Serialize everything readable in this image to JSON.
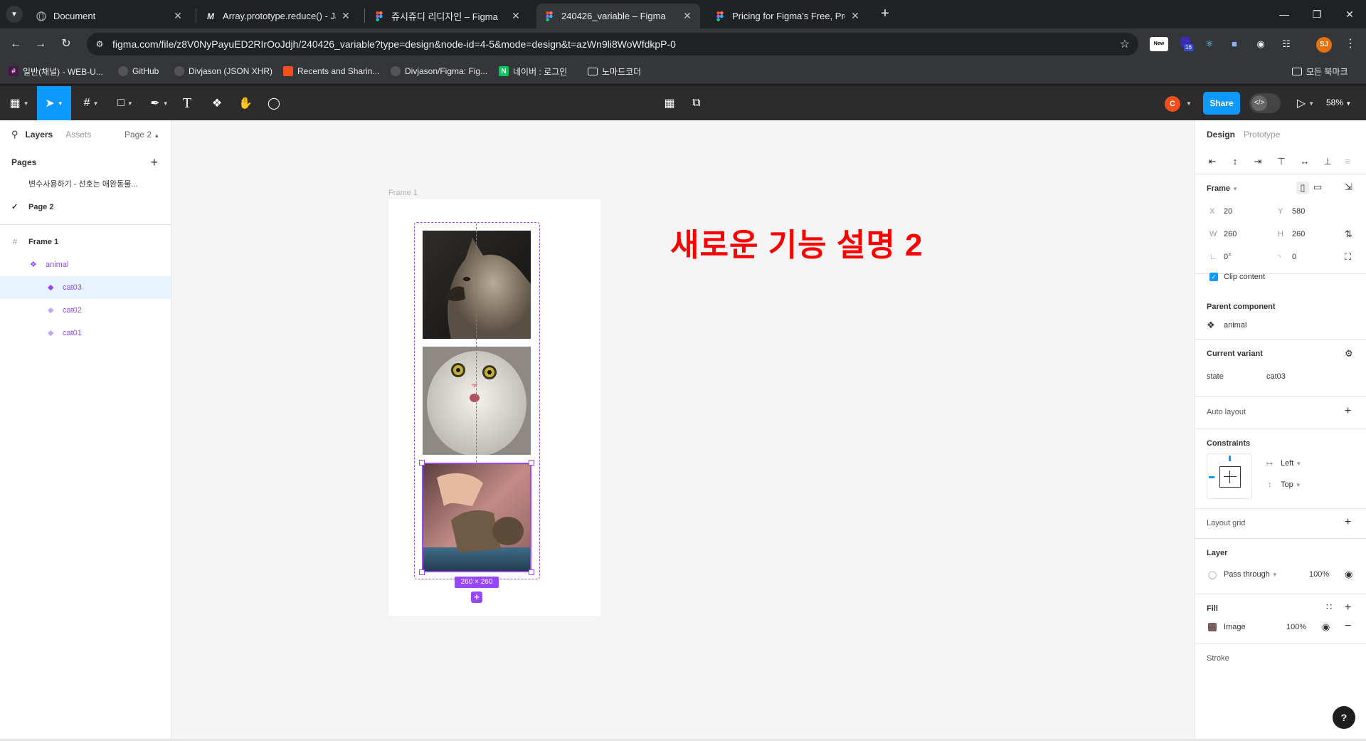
{
  "browser": {
    "tabs": [
      {
        "title": "Document",
        "icon": "globe-icon"
      },
      {
        "title": "Array.prototype.reduce() - Java",
        "icon": "mdn-icon",
        "glyph": "M"
      },
      {
        "title": "쥬시쥬디 리디자인 – Figma",
        "icon": "figma-icon"
      },
      {
        "title": "240426_variable – Figma",
        "icon": "figma-icon"
      },
      {
        "title": "Pricing for Figma's Free, Profe",
        "icon": "figma-icon"
      }
    ],
    "url": "figma.com/file/z8V0NyPayuED2RIrOoJdjh/240426_variable?type=design&node-id=4-5&mode=design&t=azWn9li8WoWfdkpP-0",
    "profile_initials": "SJ",
    "extension_badge_new": "New",
    "extension_badge_count": "16",
    "bookmarks": [
      {
        "label": "일반(채널) - WEB-U...",
        "icon": "slack-icon"
      },
      {
        "label": "GitHub",
        "icon": "github-icon"
      },
      {
        "label": "Divjason (JSON XHR)",
        "icon": "github-icon"
      },
      {
        "label": "Recents and Sharin...",
        "icon": "figma-icon"
      },
      {
        "label": "Divjason/Figma: Fig...",
        "icon": "github-icon"
      },
      {
        "label": "네이버 : 로그인",
        "icon": "naver-icon"
      },
      {
        "label": "노마드코더",
        "icon": "folder-icon"
      }
    ],
    "all_bookmarks": "모든 북마크"
  },
  "figma": {
    "toolbar": {
      "share_label": "Share",
      "zoom": "58%",
      "avatar": "C"
    },
    "left_panel": {
      "tab_layers": "Layers",
      "tab_assets": "Assets",
      "page_selector": "Page 2",
      "pages_title": "Pages",
      "pages": [
        {
          "name": "변수사용하기 - 선호는 애완동물...",
          "active": false
        },
        {
          "name": "Page 2",
          "active": true
        }
      ],
      "layers": [
        {
          "name": "Frame 1",
          "type": "frame",
          "indent": 0
        },
        {
          "name": "animal",
          "type": "component-set",
          "indent": 1
        },
        {
          "name": "cat03",
          "type": "variant",
          "indent": 2,
          "selected": true
        },
        {
          "name": "cat02",
          "type": "variant",
          "indent": 2
        },
        {
          "name": "cat01",
          "type": "variant",
          "indent": 2
        }
      ]
    },
    "canvas": {
      "frame_label": "Frame 1",
      "size_badge": "260 × 260",
      "heading_text": "새로운 기능 설명 2"
    },
    "right_panel": {
      "tab_design": "Design",
      "tab_prototype": "Prototype",
      "frame_title": "Frame",
      "x_label": "X",
      "x_value": "20",
      "y_label": "Y",
      "y_value": "580",
      "w_label": "W",
      "w_value": "260",
      "h_label": "H",
      "h_value": "260",
      "rotation": "0°",
      "radius": "0",
      "clip_content": "Clip content",
      "parent_component_title": "Parent component",
      "parent_component": "animal",
      "current_variant_title": "Current variant",
      "variant_prop": "state",
      "variant_value": "cat03",
      "auto_layout": "Auto layout",
      "constraints_title": "Constraints",
      "constraint_h": "Left",
      "constraint_v": "Top",
      "layout_grid": "Layout grid",
      "layer_title": "Layer",
      "blend_mode": "Pass through",
      "layer_opacity": "100%",
      "fill_title": "Fill",
      "fill_type": "Image",
      "fill_opacity": "100%",
      "stroke_title": "Stroke"
    }
  }
}
